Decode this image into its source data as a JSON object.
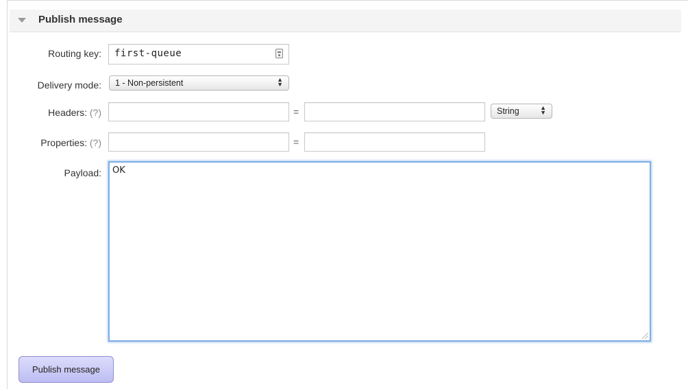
{
  "section": {
    "title": "Publish message"
  },
  "form": {
    "routing_key": {
      "label": "Routing key:",
      "value": "first-queue"
    },
    "delivery_mode": {
      "label": "Delivery mode:",
      "selected": "1 - Non-persistent"
    },
    "headers": {
      "label": "Headers:",
      "help": "(?)",
      "key_value": "",
      "equals": "=",
      "value": "",
      "type_selected": "String"
    },
    "properties": {
      "label": "Properties:",
      "help": "(?)",
      "key_value": "",
      "equals": "=",
      "value": ""
    },
    "payload": {
      "label": "Payload:",
      "value": "OK"
    }
  },
  "actions": {
    "publish_label": "Publish message"
  },
  "colors": {
    "button_bg": "#c9c9f7",
    "focus_border": "#7eaee6"
  },
  "icons": [
    "collapse-triangle-icon",
    "keychain-icon",
    "select-arrows-icon",
    "resize-grip-icon"
  ]
}
